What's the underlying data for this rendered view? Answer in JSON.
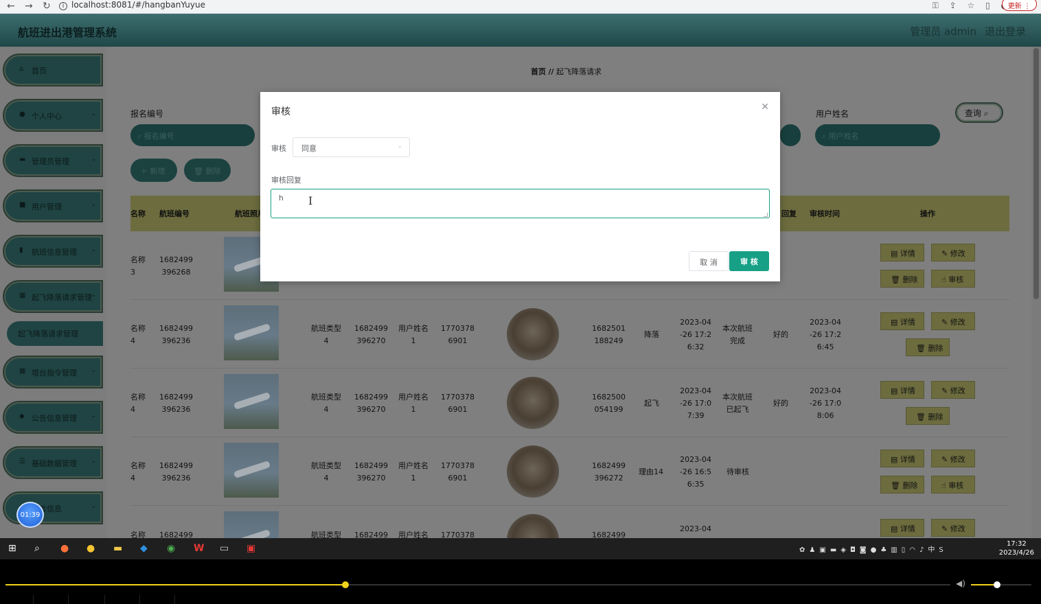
{
  "browser": {
    "url": "localhost:8081/#/hangbanYuyue",
    "update_label": "更新"
  },
  "header": {
    "title": "航班进出港管理系统",
    "admin": "管理员 admin",
    "logout": "退出登录"
  },
  "sidebar": {
    "items": [
      {
        "label": "首页",
        "icon": "home-icon"
      },
      {
        "label": "个人中心",
        "icon": "user-icon"
      },
      {
        "label": "管理员管理",
        "icon": "admin-icon"
      },
      {
        "label": "用户管理",
        "icon": "users-icon"
      },
      {
        "label": "航班信息管理",
        "icon": "clipboard-icon"
      },
      {
        "label": "起飞降落请求管理",
        "icon": "grid-icon"
      },
      {
        "label": "塔台指令管理",
        "icon": "grid-icon"
      },
      {
        "label": "公告信息管理",
        "icon": "pin-icon"
      },
      {
        "label": "基础数据管理",
        "icon": "list-icon"
      },
      {
        "label": "留言信息",
        "icon": "chat-icon"
      }
    ],
    "active_sub": "起飞降落请求管理"
  },
  "breadcrumb": {
    "home": "首页",
    "sep": "//",
    "current": "起飞降落请求"
  },
  "search": {
    "label1": "报名编号",
    "placeholder1": "报名编号",
    "label2": "用户姓名",
    "placeholder2": "用户姓名",
    "query": "查询"
  },
  "actions": {
    "add": "新增",
    "delete": "删除"
  },
  "table": {
    "headers": [
      "名称",
      "航班编号",
      "航班照片",
      "回复",
      "审核时间",
      "操作"
    ],
    "rows": [
      {
        "name": "名称\n3",
        "flight_no": "1682499\n396268",
        "type": "",
        "code": "",
        "user": "",
        "phone": "",
        "req_no": "",
        "kind": "",
        "time": "",
        "status": "",
        "reply": "",
        "audit_time": "",
        "buttons": [
          "详情",
          "修改",
          "删除",
          "审核"
        ]
      },
      {
        "name": "名称\n4",
        "flight_no": "1682499\n396236",
        "type": "航班类型\n4",
        "code": "1682499\n396270",
        "user": "用户姓名\n1",
        "phone": "1770378\n6901",
        "req_no": "1682501\n188249",
        "kind": "降落",
        "time": "2023-04\n-26 17:2\n6:32",
        "status": "本次航班\n完成",
        "reply": "好的",
        "audit_time": "2023-04\n-26 17:2\n6:45",
        "buttons": [
          "详情",
          "修改",
          "删除"
        ]
      },
      {
        "name": "名称\n4",
        "flight_no": "1682499\n396236",
        "type": "航班类型\n4",
        "code": "1682499\n396270",
        "user": "用户姓名\n1",
        "phone": "1770378\n6901",
        "req_no": "1682500\n054199",
        "kind": "起飞",
        "time": "2023-04\n-26 17:0\n7:39",
        "status": "本次航班\n已起飞",
        "reply": "好的",
        "audit_time": "2023-04\n-26 17:0\n8:06",
        "buttons": [
          "详情",
          "修改",
          "删除"
        ]
      },
      {
        "name": "名称\n4",
        "flight_no": "1682499\n396236",
        "type": "航班类型\n4",
        "code": "1682499\n396270",
        "user": "用户姓名\n1",
        "phone": "1770378\n6901",
        "req_no": "1682499\n396272",
        "kind": "理由14",
        "time": "2023-04\n-26 16:5\n6:35",
        "status": "待审核",
        "reply": "",
        "audit_time": "",
        "buttons": [
          "详情",
          "修改",
          "删除",
          "审核"
        ]
      },
      {
        "name": "名称",
        "flight_no": "1682499",
        "type": "航班类型",
        "code": "1682499",
        "user": "用户姓名",
        "phone": "1770378",
        "req_no": "1682499",
        "kind": "",
        "time": "2023-04",
        "status": "",
        "reply": "",
        "audit_time": "",
        "buttons": [
          "详情",
          "修改"
        ]
      }
    ]
  },
  "modal": {
    "title": "审核",
    "audit_label": "审核",
    "audit_value": "同意",
    "reply_label": "审核回复",
    "reply_value": "h",
    "cancel": "取 消",
    "confirm": "审 核"
  },
  "timer": "01:39",
  "taskbar": {
    "time": "17:32",
    "date": "2023/4/26",
    "ime": "中"
  },
  "player": {
    "progress": 0.36,
    "volume": 0.43
  },
  "colors": {
    "accent": "#17a085",
    "sidebar": "#1f4443",
    "header_bg": "#6c6c3f"
  }
}
